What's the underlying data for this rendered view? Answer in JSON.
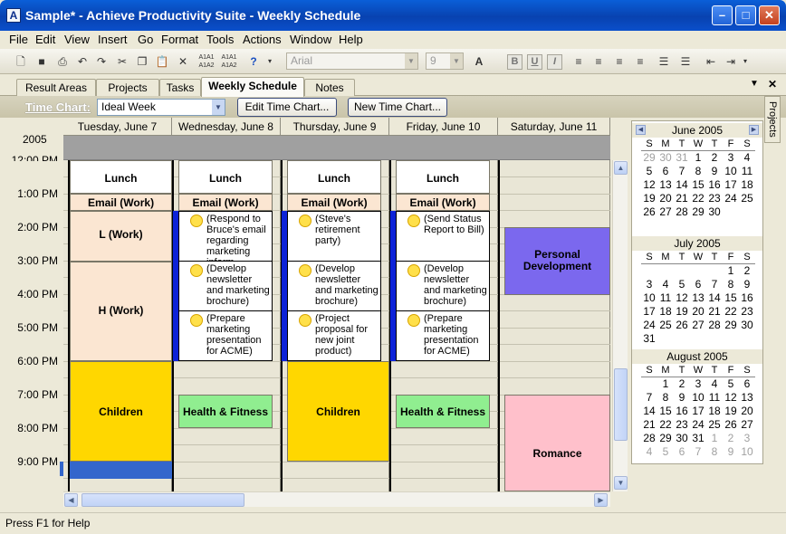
{
  "window": {
    "title": "Sample* - Achieve Productivity Suite - Weekly Schedule",
    "app_icon": "A"
  },
  "menu": [
    "File",
    "Edit",
    "View",
    "Insert",
    "Go",
    "Format",
    "Tools",
    "Actions",
    "Window",
    "Help"
  ],
  "toolbar": {
    "font": "Arial",
    "size": "9",
    "icons": [
      "new-icon",
      "save-icon",
      "print-icon",
      "undo-icon",
      "redo-icon",
      "cut-icon",
      "copy-icon",
      "paste-icon",
      "delete-icon",
      "renumber-icon",
      "renumber-icon",
      "help-icon"
    ]
  },
  "tabs": [
    "Result Areas",
    "Projects",
    "Tasks",
    "Weekly Schedule",
    "Notes"
  ],
  "active_tab": "Weekly Schedule",
  "timechart": {
    "label": "Time Chart:",
    "value": "Ideal Week",
    "edit_btn": "Edit Time Chart...",
    "new_btn": "New Time Chart..."
  },
  "schedule": {
    "year": "2005",
    "days": [
      "Tuesday, June 7",
      "Wednesday, June 8",
      "Thursday, June 9",
      "Friday, June 10",
      "Saturday, June 11"
    ],
    "times": [
      "12:00 PM",
      "1:00 PM",
      "2:00 PM",
      "3:00 PM",
      "4:00 PM",
      "5:00 PM",
      "6:00 PM",
      "7:00 PM",
      "8:00 PM",
      "9:00 PM"
    ],
    "events": {
      "lunch": "Lunch",
      "email": "Email (Work)",
      "l_work": "L (Work)",
      "h_work": "H (Work)",
      "children": "Children",
      "health": "Health & Fitness",
      "personal": "Personal Development",
      "romance": "Romance"
    },
    "tasks": {
      "wed_1": "(Respond to Bruce's email regarding marketing inform",
      "wed_2": "(Develop newsletter and marketing brochure)",
      "wed_3": "(Prepare marketing presentation for ACME)",
      "thu_1": "(Steve's retirement party)",
      "thu_2": "(Develop newsletter and marketing brochure)",
      "thu_3": "(Project proposal for new joint product)",
      "fri_1": "(Send Status Report to Bill)",
      "fri_2": "(Develop newsletter and marketing brochure)",
      "fri_3": "(Prepare marketing presentation for ACME)"
    }
  },
  "calendars": [
    {
      "month": "June 2005",
      "weeks": [
        [
          "29",
          "30",
          "31",
          "1",
          "2",
          "3",
          "4"
        ],
        [
          "5",
          "6",
          "7",
          "8",
          "9",
          "10",
          "11"
        ],
        [
          "12",
          "13",
          "14",
          "15",
          "16",
          "17",
          "18"
        ],
        [
          "19",
          "20",
          "21",
          "22",
          "23",
          "24",
          "25"
        ],
        [
          "26",
          "27",
          "28",
          "29",
          "30",
          "",
          ""
        ]
      ]
    },
    {
      "month": "July 2005",
      "weeks": [
        [
          "",
          "",
          "",
          "",
          "",
          "1",
          "2"
        ],
        [
          "3",
          "4",
          "5",
          "6",
          "7",
          "8",
          "9"
        ],
        [
          "10",
          "11",
          "12",
          "13",
          "14",
          "15",
          "16"
        ],
        [
          "17",
          "18",
          "19",
          "20",
          "21",
          "22",
          "23"
        ],
        [
          "24",
          "25",
          "26",
          "27",
          "28",
          "29",
          "30"
        ],
        [
          "31",
          "",
          "",
          "",
          "",
          "",
          ""
        ]
      ]
    },
    {
      "month": "August 2005",
      "weeks": [
        [
          "",
          "1",
          "2",
          "3",
          "4",
          "5",
          "6"
        ],
        [
          "7",
          "8",
          "9",
          "10",
          "11",
          "12",
          "13"
        ],
        [
          "14",
          "15",
          "16",
          "17",
          "18",
          "19",
          "20"
        ],
        [
          "21",
          "22",
          "23",
          "24",
          "25",
          "26",
          "27"
        ],
        [
          "28",
          "29",
          "30",
          "31",
          "1",
          "2",
          "3"
        ],
        [
          "4",
          "5",
          "6",
          "7",
          "8",
          "9",
          "10"
        ]
      ]
    }
  ],
  "dow": [
    "S",
    "M",
    "T",
    "W",
    "T",
    "F",
    "S"
  ],
  "side_tab": "Projects",
  "status": "Press F1 for Help",
  "colors": {
    "title": "#0842b0",
    "work": "#fbe6d2",
    "children": "#ffd700",
    "health": "#90ee90",
    "personal": "#7b68ee",
    "romance": "#ffc0cb",
    "task_bar": "#0d23d8"
  }
}
